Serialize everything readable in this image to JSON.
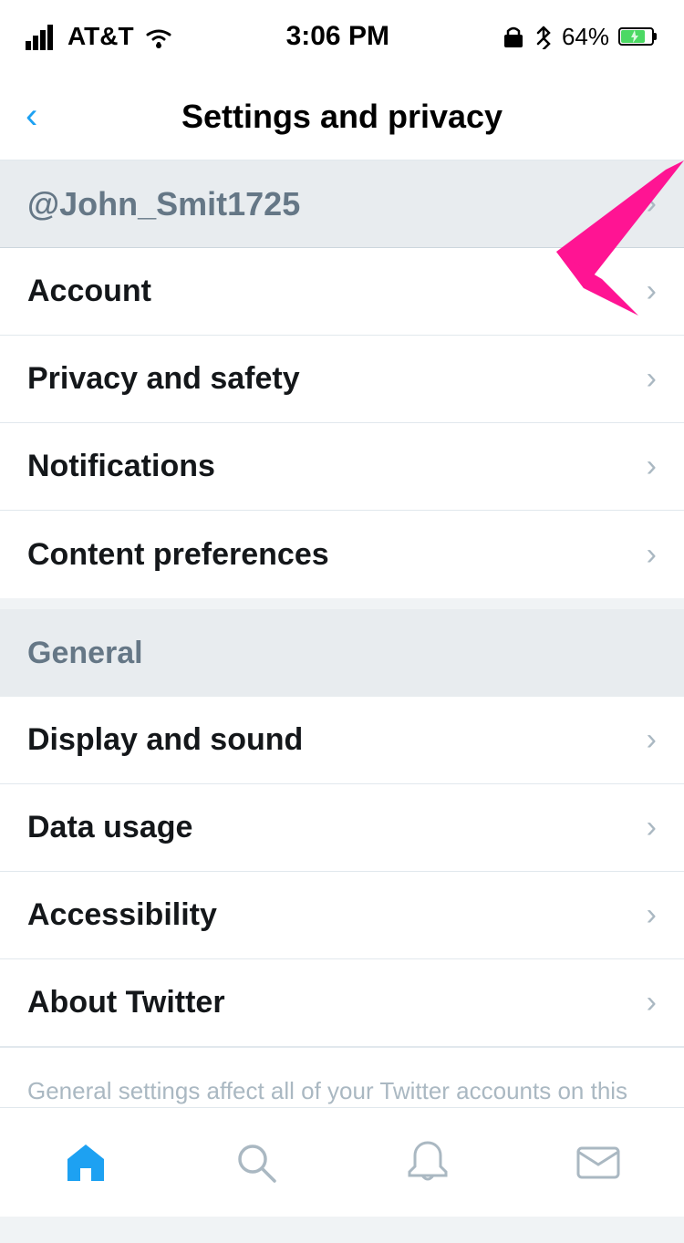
{
  "statusBar": {
    "carrier": "AT&T",
    "time": "3:06 PM",
    "battery": "64%"
  },
  "navBar": {
    "title": "Settings and privacy",
    "backLabel": "‹"
  },
  "accountSection": {
    "username": "@John_Smit1725"
  },
  "settingsItems": [
    {
      "id": "account",
      "label": "Account"
    },
    {
      "id": "privacy",
      "label": "Privacy and safety"
    },
    {
      "id": "notifications",
      "label": "Notifications"
    },
    {
      "id": "content",
      "label": "Content preferences"
    }
  ],
  "generalSection": {
    "header": "General",
    "items": [
      {
        "id": "display",
        "label": "Display and sound"
      },
      {
        "id": "data",
        "label": "Data usage"
      },
      {
        "id": "accessibility",
        "label": "Accessibility"
      },
      {
        "id": "about",
        "label": "About Twitter"
      }
    ],
    "footerNote": "General settings affect all of your Twitter accounts on this device."
  },
  "tabBar": {
    "items": [
      {
        "id": "home",
        "icon": "🏠",
        "active": true
      },
      {
        "id": "search",
        "icon": "🔍",
        "active": false
      },
      {
        "id": "notifications",
        "icon": "🔔",
        "active": false
      },
      {
        "id": "messages",
        "icon": "✉",
        "active": false
      }
    ]
  }
}
